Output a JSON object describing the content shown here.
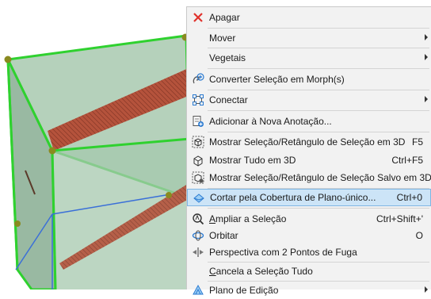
{
  "menu": {
    "items": [
      {
        "label": "Apagar",
        "icon": "close-x-icon"
      },
      {
        "label": "Mover",
        "submenu": true
      },
      {
        "label": "Vegetais",
        "submenu": true
      },
      {
        "label": "Converter Seleção em Morph(s)",
        "icon": "morph-convert-icon"
      },
      {
        "label": "Conectar",
        "icon": "connect-icon",
        "submenu": true
      },
      {
        "label": "Adicionar à Nova Anotação...",
        "icon": "annotation-icon"
      },
      {
        "label": "Mostrar Seleção/Retângulo de Seleção em 3D",
        "shortcut": "F5",
        "icon": "show-3d-selection-icon"
      },
      {
        "label": "Mostrar Tudo em 3D",
        "shortcut": "Ctrl+F5",
        "icon": "show-all-3d-icon"
      },
      {
        "label": "Mostrar Seleção/Retângulo de Seleção Salvo em 3D",
        "icon": "show-saved-3d-icon"
      },
      {
        "label": "Cortar pela Cobertura de Plano-único...",
        "shortcut": "Ctrl+0",
        "icon": "trim-roof-icon",
        "highlighted": true
      },
      {
        "label": "Ampliar a Seleção",
        "shortcut": "Ctrl+Shift+'",
        "icon": "zoom-selection-icon"
      },
      {
        "label": "Orbitar",
        "shortcut": "O",
        "icon": "orbit-icon"
      },
      {
        "label": "Perspectiva com 2 Pontos de Fuga",
        "icon": "two-point-perspective-icon"
      },
      {
        "label": "Cancela a Seleção Tudo"
      },
      {
        "label": "Plano de Edição",
        "icon": "editing-plane-icon",
        "submenu": true
      }
    ]
  },
  "colors": {
    "menu_bg": "#f2f2f2",
    "highlight_bg": "#cce4f7",
    "highlight_border": "#7fb6e3",
    "model_edge_green": "#2fd12f",
    "glass_fill": "#8fb89a",
    "roof_brick": "#b5533c",
    "axis_blue": "#3a6fd8"
  }
}
